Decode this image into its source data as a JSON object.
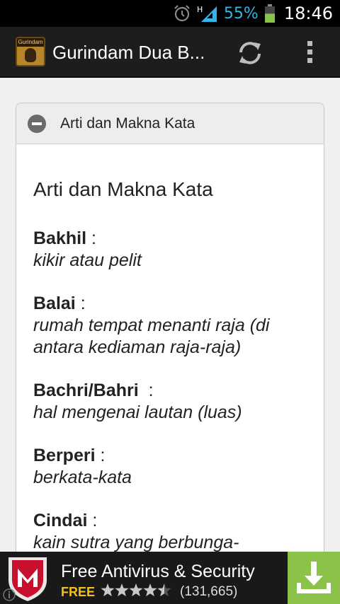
{
  "statusbar": {
    "network_label": "H",
    "battery_percent": "55%",
    "battery_level": 0.55,
    "time": "18:46",
    "icons": [
      "alarm-icon",
      "signal-icon",
      "battery-icon"
    ]
  },
  "actionbar": {
    "app_icon_text": "Gurindam",
    "title": "Gurindam Dua B...",
    "icons": [
      "refresh-icon",
      "overflow-menu-icon"
    ]
  },
  "card": {
    "header_title": "Arti dan Makna Kata",
    "heading": "Arti dan Makna Kata",
    "entries": [
      {
        "term": "Bakhil",
        "suffix": " :",
        "meaning": "kikir atau pelit"
      },
      {
        "term": "Balai",
        "suffix": " :",
        "meaning": "rumah tempat menanti raja (di antara kediaman raja-raja)"
      },
      {
        "term": "Bachri/Bahri",
        "suffix": "  :",
        "meaning": "hal mengenai lautan (luas)"
      },
      {
        "term": "Berperi",
        "suffix": " :",
        "meaning": "berkata-kata"
      },
      {
        "term": "Cindai",
        "suffix": " :",
        "meaning": "kain sutra yang berbunga-"
      }
    ]
  },
  "ad": {
    "title": "Free Antivirus & Security",
    "price": "FREE",
    "rating": 4.5,
    "rating_count": "(131,665)",
    "colors": {
      "download_bg": "#8bc34a",
      "logo_red": "#c8102e"
    }
  }
}
